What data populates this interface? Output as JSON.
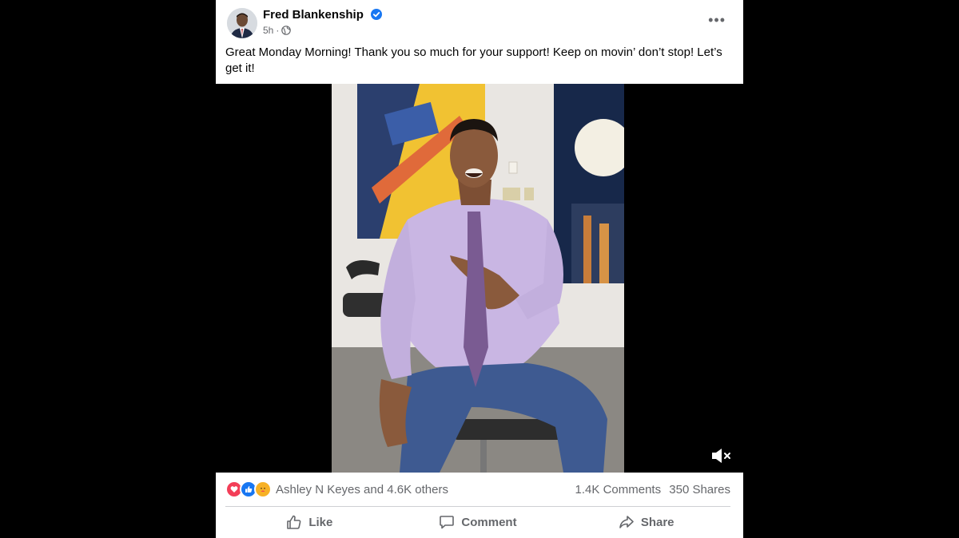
{
  "post": {
    "author": "Fred Blankenship",
    "time": "5h",
    "separator": "·",
    "caption": "Great Monday Morning! Thank you so much for your support! Keep on movin’ don’t stop! Let’s get it!",
    "more_label": "•••"
  },
  "reactions": {
    "icons": [
      "love-icon",
      "like-icon",
      "care-icon"
    ],
    "summary": "Ashley N Keyes and 4.6K others"
  },
  "counts": {
    "comments": "1.4K Comments",
    "shares": "350 Shares"
  },
  "actions": {
    "like": "Like",
    "comment": "Comment",
    "share": "Share"
  },
  "colors": {
    "facebook_blue": "#1877f2",
    "love_red": "#f33e58",
    "care_yellow": "#f7b125",
    "text_secondary": "#65676b"
  }
}
